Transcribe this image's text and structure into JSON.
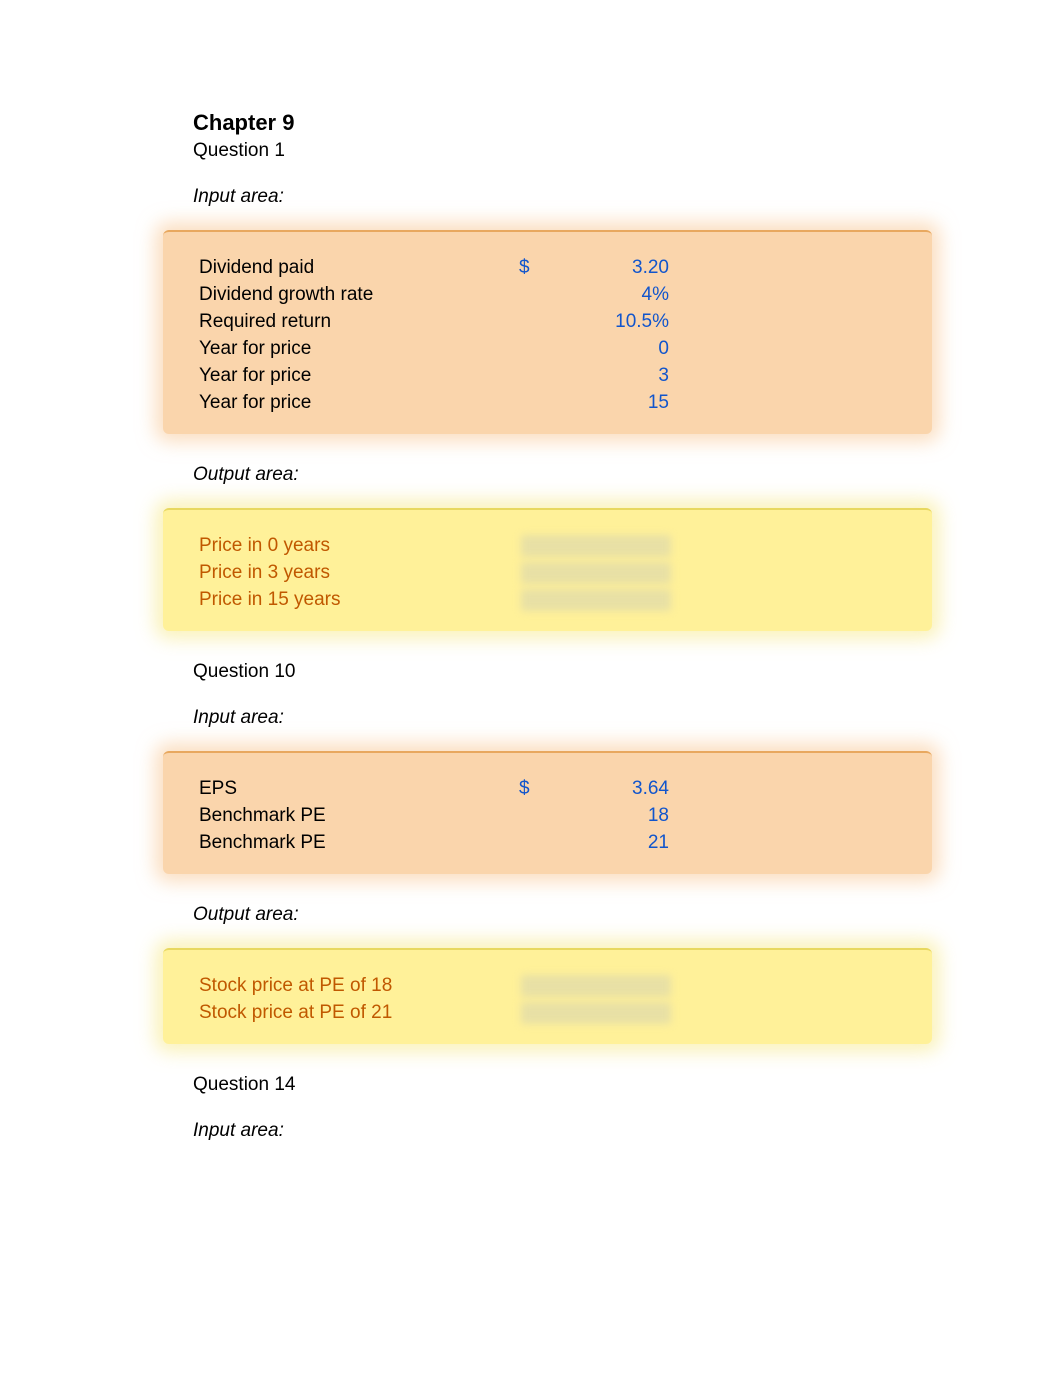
{
  "header": {
    "title": "Chapter 9",
    "question1": "Question 1",
    "input_label": "Input area:",
    "output_label": "Output area:",
    "question10": "Question 10",
    "question14": "Question 14"
  },
  "q1_input": {
    "rows": [
      {
        "label": "Dividend paid",
        "currency": "$",
        "value": "3.20"
      },
      {
        "label": "Dividend growth rate",
        "currency": "",
        "value": "4%"
      },
      {
        "label": "Required return",
        "currency": "",
        "value": "10.5%"
      },
      {
        "label": "Year for price",
        "currency": "",
        "value": "0"
      },
      {
        "label": "Year for price",
        "currency": "",
        "value": "3"
      },
      {
        "label": "Year for price",
        "currency": "",
        "value": "15"
      }
    ]
  },
  "q1_output": {
    "rows": [
      {
        "label": "Price in 0 years"
      },
      {
        "label": "Price in 3 years"
      },
      {
        "label": "Price in 15 years"
      }
    ]
  },
  "q10_input": {
    "rows": [
      {
        "label": "EPS",
        "currency": "$",
        "value": "3.64"
      },
      {
        "label": "Benchmark PE",
        "currency": "",
        "value": "18"
      },
      {
        "label": "Benchmark PE",
        "currency": "",
        "value": "21"
      }
    ]
  },
  "q10_output": {
    "rows": [
      {
        "label": "Stock price at PE of 18"
      },
      {
        "label": "Stock price at PE of 21"
      }
    ]
  }
}
